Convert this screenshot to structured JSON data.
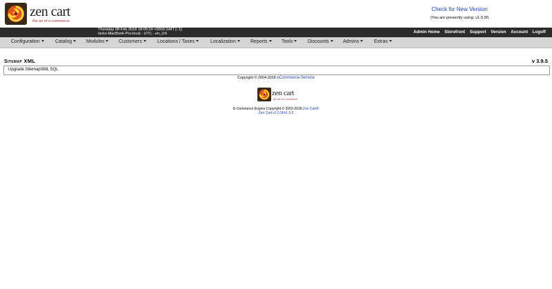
{
  "header": {
    "logo_word": "zen cart",
    "logo_tagline": "the art of e-commerce",
    "check_version_label": "Check for New Version",
    "presently_using": "(You are presently using: v1.5.5f)"
  },
  "infobar": {
    "datetime": "Thursday 08 Feb 2018 18:05:24 +0000 GMT [::1]",
    "host": "nicks-MacBook-Pro.local - UTC - en_US",
    "links": [
      "Admin Home",
      "Storefront",
      "Support",
      "Version",
      "Account",
      "Logoff"
    ]
  },
  "menu": {
    "items": [
      "Configuration",
      "Catalog",
      "Modules",
      "Customers",
      "Locations / Taxes",
      "Localization",
      "Reports",
      "Tools",
      "Discounts",
      "Admins",
      "Extras"
    ]
  },
  "page": {
    "title": "Sitemap XML",
    "version": "v 3.9.5",
    "upgrade_link": "Upgrade SitemapXML SQL"
  },
  "footer": {
    "copyright_prefix": "Copyright © 2004-2018",
    "copyright_link": "eCommerce-Service",
    "logo_word": "zen cart",
    "logo_tagline": "the art of e-commerce",
    "engine_text": "E-Commerce Engine Copyright © 2003-2018",
    "engine_link": "Zen Cart®",
    "engine_version": "Zen Cart v1.5.5f/v1.5.5"
  },
  "colors": {
    "link": "#1e3fa8",
    "infobar_bg": "#2b2b2b",
    "menubar_bg": "#d5d5d5"
  }
}
